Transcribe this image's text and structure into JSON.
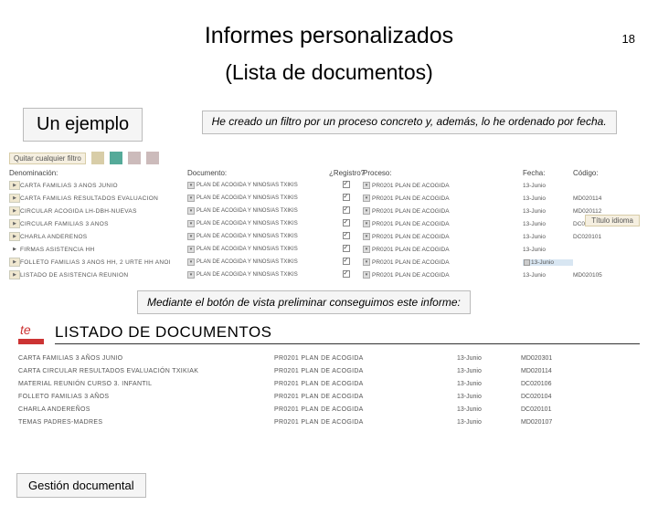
{
  "page_number": "18",
  "title": "Informes personalizados",
  "subtitle": "(Lista de documentos)",
  "section_header": "Un ejemplo",
  "callout1": "He creado un filtro por un proceso concreto y, además, lo he ordenado por fecha.",
  "callout2": "Mediante el botón de vista preliminar conseguimos este informe:",
  "footer": "Gestión documental",
  "toolbar": {
    "quitar": "Quitar cualquier filtro",
    "titulo_idioma": "Título idioma"
  },
  "columns": {
    "denom": "Denominación:",
    "doc": "Documento:",
    "reg": "¿Registro?",
    "proc": "Proceso:",
    "fecha": "Fecha:",
    "codigo": "Código:"
  },
  "rows": [
    {
      "marker": "",
      "denom": "CARTA FAMILIAS 3 AÑOS JUNIO",
      "doc": "",
      "proc": "PR0201 PLAN DE ACOGIDA",
      "fecha": "13-Junio",
      "codigo": ""
    },
    {
      "marker": "",
      "denom": "CARTA FAMILIAS RESULTADOS EVALUACIÓN",
      "doc": "",
      "proc": "PR0201 PLAN DE ACOGIDA",
      "fecha": "13-Junio",
      "codigo": "MD020114"
    },
    {
      "marker": "",
      "denom": "CIRCULAR ACOGIDA LH-DBH-NUEVAS",
      "doc": "",
      "proc": "PR0201 PLAN DE ACOGIDA",
      "fecha": "13-Junio",
      "codigo": "MD020112"
    },
    {
      "marker": "",
      "denom": "CIRCULAR FAMILIAS 3 AÑOS",
      "doc": "",
      "proc": "PR0201 PLAN DE ACOGIDA",
      "fecha": "13-Junio",
      "codigo": "DC020104"
    },
    {
      "marker": "",
      "denom": "CHARLA ANDEREÑOS",
      "doc": "",
      "proc": "PR0201 PLAN DE ACOGIDA",
      "fecha": "13-Junio",
      "codigo": "DC020101"
    },
    {
      "marker": "play",
      "denom": "FIRMAS ASISTENCIA HH",
      "doc": "",
      "proc": "PR0201 PLAN DE ACOGIDA",
      "fecha": "13-Junio",
      "codigo": ""
    },
    {
      "marker": "",
      "denom": "FOLLETO FAMILIAS 3 AÑOS HH, 2 URTE HH ANOI",
      "doc": "",
      "proc": "PR0201 PLAN DE ACOGIDA",
      "fecha": "13-Junio",
      "codigo": "",
      "active_fecha": true
    },
    {
      "marker": "",
      "denom": "LISTADO DE ASISTENCIA REUNIÓN",
      "doc": "",
      "proc": "PR0201 PLAN DE ACOGIDA",
      "fecha": "13-Junio",
      "codigo": "MD020105"
    }
  ],
  "report": {
    "title": "LISTADO DE DOCUMENTOS",
    "rows": [
      {
        "denom": "CARTA FAMILIAS 3 AÑOS JUNIO",
        "proc": "PR0201 PLAN DE ACOGIDA",
        "fecha": "13-Junio",
        "codigo": "MD020301"
      },
      {
        "denom": "CARTA CIRCULAR RESULTADOS EVALUACIÓN TXIKIAK",
        "proc": "PR0201 PLAN DE ACOGIDA",
        "fecha": "13-Junio",
        "codigo": "MD020114"
      },
      {
        "denom": "MATERIAL REUNIÓN CURSO 3. INFANTIL",
        "proc": "PR0201 PLAN DE ACOGIDA",
        "fecha": "13-Junio",
        "codigo": "DC020106"
      },
      {
        "denom": "FOLLETO FAMILIAS 3 AÑOS",
        "proc": "PR0201 PLAN DE ACOGIDA",
        "fecha": "13-Junio",
        "codigo": "DC020104"
      },
      {
        "denom": "CHARLA ANDEREÑOS",
        "proc": "PR0201 PLAN DE ACOGIDA",
        "fecha": "13-Junio",
        "codigo": "DC020101"
      },
      {
        "denom": "TEMAS PADRES-MADRES",
        "proc": "PR0201 PLAN DE ACOGIDA",
        "fecha": "13-Junio",
        "codigo": "MD020107"
      }
    ]
  }
}
